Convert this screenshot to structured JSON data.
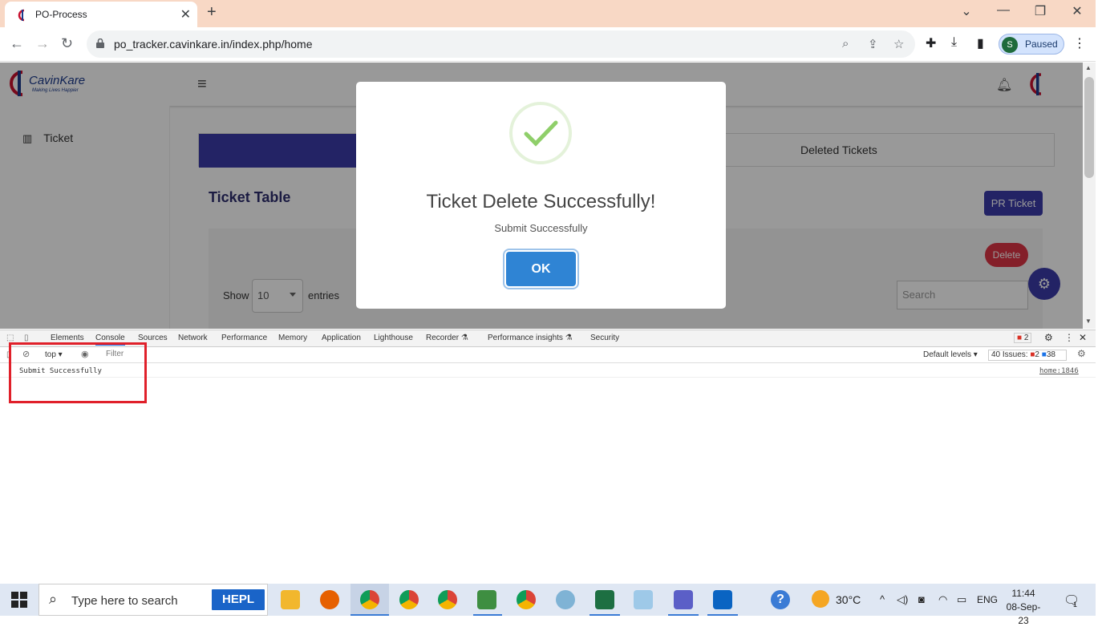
{
  "browser": {
    "tab_title": "PO-Process",
    "close_tab": "✕",
    "new_tab": "+",
    "url": "po_tracker.cavinkare.in/index.php/home",
    "profile_initial": "S",
    "profile_status": "Paused"
  },
  "app": {
    "logo_text": "CavinKare",
    "logo_tagline": "Making Lives Happier",
    "sidebar_item": "Ticket",
    "tab_deleted": "Deleted Tickets",
    "table_title": "Ticket Table",
    "pr_ticket_button": "PR Ticket",
    "delete_button": "Delete",
    "show_label": "Show",
    "entries_value": "10",
    "entries_label": "entries",
    "search_placeholder": "Search"
  },
  "modal": {
    "title": "Ticket Delete Successfully!",
    "subtitle": "Submit Successfully",
    "ok_button": "OK"
  },
  "devtools": {
    "tabs": [
      "Elements",
      "Console",
      "Sources",
      "Network",
      "Performance",
      "Memory",
      "Application",
      "Lighthouse",
      "Recorder ⚗",
      "Performance insights ⚗",
      "Security"
    ],
    "error_badge": "2",
    "context": "top",
    "filter_placeholder": "Filter",
    "levels": "Default levels",
    "issues_text": "40 Issues:",
    "issues_errors": "2",
    "issues_info": "38",
    "console_message": "Submit Successfully",
    "console_source": "home:1846"
  },
  "taskbar": {
    "search_placeholder": "Type here to search",
    "hepl_label": "HEPL",
    "temperature": "30°C",
    "language": "ENG",
    "time": "11:44",
    "date": "08-Sep-23",
    "notification_count": "1"
  },
  "colors": {
    "accent": "#3b3ba8",
    "danger": "#dc3545",
    "ok_button": "#2f84d4",
    "success_check": "#8fcf6a",
    "highlight_box": "#e0202a"
  }
}
